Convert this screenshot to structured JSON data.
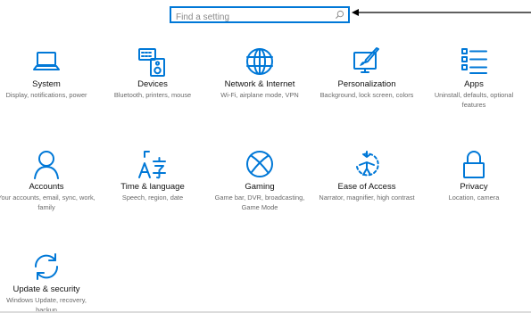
{
  "search": {
    "placeholder": "Find a setting"
  },
  "tiles": [
    {
      "name": "System",
      "desc": "Display, notifications, power",
      "icon": "laptop-icon"
    },
    {
      "name": "Devices",
      "desc": "Bluetooth, printers, mouse",
      "icon": "keyboard-speaker-icon"
    },
    {
      "name": "Network & Internet",
      "desc": "Wi-Fi, airplane mode, VPN",
      "icon": "globe-icon"
    },
    {
      "name": "Personalization",
      "desc": "Background, lock screen, colors",
      "icon": "paint-monitor-icon"
    },
    {
      "name": "Apps",
      "desc": "Uninstall, defaults, optional features",
      "icon": "apps-list-icon"
    },
    {
      "name": "Accounts",
      "desc": "Your accounts, email, sync, work, family",
      "icon": "person-icon"
    },
    {
      "name": "Time & language",
      "desc": "Speech, region, date",
      "icon": "time-language-icon"
    },
    {
      "name": "Gaming",
      "desc": "Game bar, DVR, broadcasting, Game Mode",
      "icon": "xbox-icon"
    },
    {
      "name": "Ease of Access",
      "desc": "Narrator, magnifier, high contrast",
      "icon": "ease-of-access-icon"
    },
    {
      "name": "Privacy",
      "desc": "Location, camera",
      "icon": "lock-icon"
    },
    {
      "name": "Update & security",
      "desc": "Windows Update, recovery, backup",
      "icon": "sync-arrows-icon"
    }
  ],
  "colors": {
    "accent": "#0078d7",
    "text": "#111111",
    "subtext": "#6a6a6a"
  }
}
